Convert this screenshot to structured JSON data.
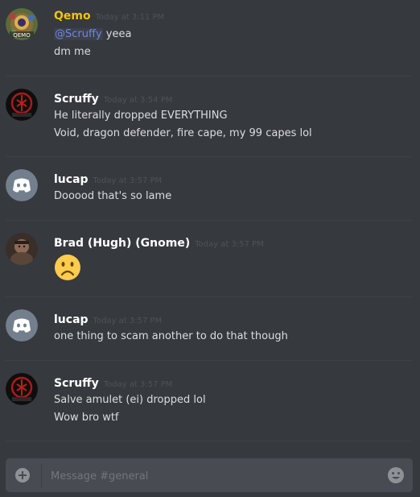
{
  "app": {
    "title": "Discord"
  },
  "colors": {
    "background": "#36393e",
    "qemo": "#f1c40f",
    "white_name": "#ffffff",
    "mention": "#7289da",
    "timestamp": "#4f5256"
  },
  "messages": [
    {
      "username": "Qemo",
      "timestamp": "Today at 3:11 PM",
      "avatar_icon": "qemo-avatar-icon",
      "lines": [
        {
          "mention": "@Scruffy",
          "text": " yeea"
        },
        {
          "text": "dm me"
        }
      ]
    },
    {
      "username": "Scruffy",
      "timestamp": "Today at 3:54 PM",
      "avatar_icon": "scruffy-avatar-icon",
      "lines": [
        {
          "text": "He literally dropped EVERYTHING"
        },
        {
          "text": "Void, dragon defender, fire cape, my 99 capes lol"
        }
      ]
    },
    {
      "username": "lucap",
      "timestamp": "Today at 3:57 PM",
      "avatar_icon": "discord-default-avatar-icon",
      "lines": [
        {
          "text": "Dooood that's so lame"
        }
      ]
    },
    {
      "username": "Brad (Hugh) (Gnome)",
      "timestamp": "Today at 3:57 PM",
      "avatar_icon": "brad-avatar-icon",
      "lines": [
        {
          "emoji": "frowning-face-emoji"
        }
      ]
    },
    {
      "username": "lucap",
      "timestamp": "Today at 3:57 PM",
      "avatar_icon": "discord-default-avatar-icon",
      "lines": [
        {
          "text": "one thing to scam another to do that though"
        }
      ]
    },
    {
      "username": "Scruffy",
      "timestamp": "Today at 3:57 PM",
      "avatar_icon": "scruffy-avatar-icon",
      "lines": [
        {
          "text": "Salve amulet (ei) dropped lol"
        },
        {
          "text": "Wow bro wtf"
        }
      ]
    }
  ],
  "composer": {
    "placeholder": "Message #general",
    "value": "",
    "add_icon": "plus-circle-icon",
    "emoji_icon": "smiley-icon"
  }
}
